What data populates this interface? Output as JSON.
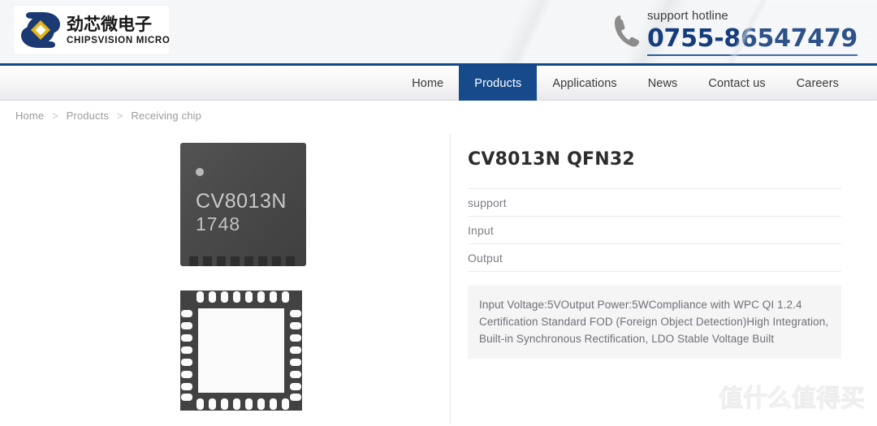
{
  "brand": {
    "logo_icon": "chipsvision-diamond-logo-icon",
    "name_cn": "劲芯微电子",
    "name_en": "CHIPSVISION MICRO",
    "logo_navy": "#1b3a73",
    "logo_gold": "#e3b419"
  },
  "hotline": {
    "icon": "phone-icon",
    "label": "support hotline",
    "number": "0755-86547479",
    "number_color": "#153d7c"
  },
  "nav": {
    "active": "Products",
    "active_bg": "#174a8b",
    "items": [
      {
        "label": "Home"
      },
      {
        "label": "Products"
      },
      {
        "label": "Applications"
      },
      {
        "label": "News"
      },
      {
        "label": "Contact us"
      },
      {
        "label": "Careers"
      }
    ]
  },
  "breadcrumb": {
    "separator": ">",
    "items": [
      {
        "label": "Home"
      },
      {
        "label": "Products"
      },
      {
        "label": "Receiving chip"
      }
    ]
  },
  "gallery": {
    "top_image": {
      "alt": "chip-top-view",
      "marking_line1": "CV8013N",
      "marking_line2": "1748",
      "dot_marker": "pin1-dot-marker"
    },
    "bottom_image": {
      "alt": "chip-bottom-view-qfn-pads",
      "pad_count_per_side": 8
    }
  },
  "product": {
    "title": "CV8013N QFN32",
    "specs": [
      {
        "label": "support"
      },
      {
        "label": "Input"
      },
      {
        "label": "Output"
      }
    ],
    "description": "Input Voltage:5VOutput Power:5WCompliance with WPC QI 1.2.4 Certification Standard FOD (Foreign Object Detection)High Integration, Built-in Synchronous Rectification, LDO Stable Voltage Built",
    "desc_bg": "#f5f5f6"
  },
  "watermark": {
    "text": "值什么值得买"
  }
}
